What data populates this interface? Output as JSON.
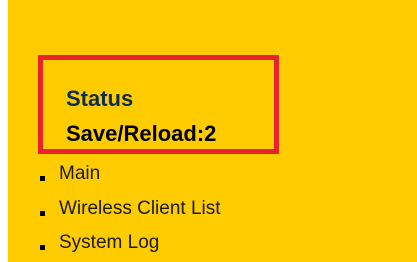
{
  "section": {
    "title": "Status",
    "save_reload": "Save/Reload:2"
  },
  "menu": {
    "items": [
      {
        "label": "Main"
      },
      {
        "label": "Wireless Client List"
      },
      {
        "label": "System Log"
      }
    ]
  },
  "colors": {
    "panel_background": "#ffcc00",
    "highlight_border": "#e8232b",
    "title_text": "#0d2c54"
  }
}
